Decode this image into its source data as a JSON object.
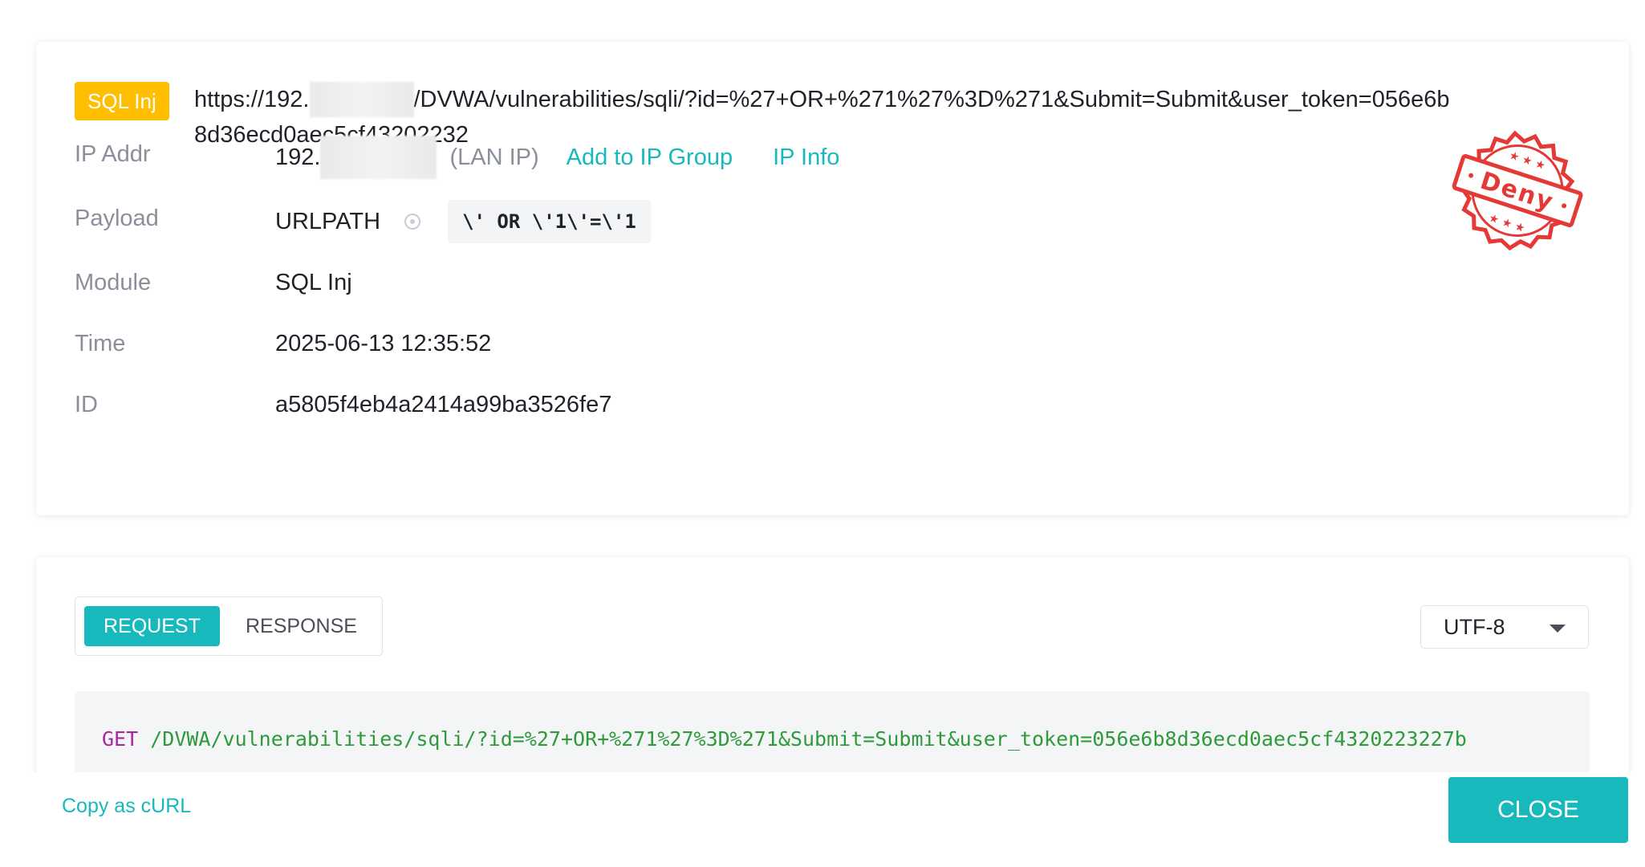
{
  "header": {
    "attack_tag": "SQL Inj",
    "url_prefix": "https://192.",
    "url_suffix": "/DVWA/vulnerabilities/sqli/?id=%27+OR+%271%27%3D%271&Submit=Submit&user_token=056e6b8d36ecd0aec5cf43202232"
  },
  "stamp": {
    "text": "Deny",
    "color": "#e53935"
  },
  "fields": {
    "ip": {
      "label": "IP Addr",
      "value_prefix": "192.",
      "network": "(LAN IP)",
      "add_group_link": "Add to IP Group",
      "info_link": "IP Info"
    },
    "payload": {
      "label": "Payload",
      "location": "URLPATH",
      "value": "\\' OR \\'1\\'=\\'1"
    },
    "module": {
      "label": "Module",
      "value": "SQL Inj"
    },
    "time": {
      "label": "Time",
      "value": "2025-06-13 12:35:52"
    },
    "id": {
      "label": "ID",
      "value": "a5805f4eb4a2414a99ba3526fe7"
    }
  },
  "request_panel": {
    "tabs": [
      "REQUEST",
      "RESPONSE"
    ],
    "active_tab": "REQUEST",
    "encoding": "UTF-8",
    "request_method": "GET",
    "request_path": "/DVWA/vulnerabilities/sqli/?id=%27+OR+%271%27%3D%271&Submit=Submit&user_token=056e6b8d36ecd0aec5cf4320223227b"
  },
  "footer": {
    "copy_curl": "Copy as cURL",
    "close_label": "CLOSE"
  },
  "colors": {
    "accent": "#17b9bd",
    "tag": "#ffbf00",
    "stamp": "#e53935"
  }
}
